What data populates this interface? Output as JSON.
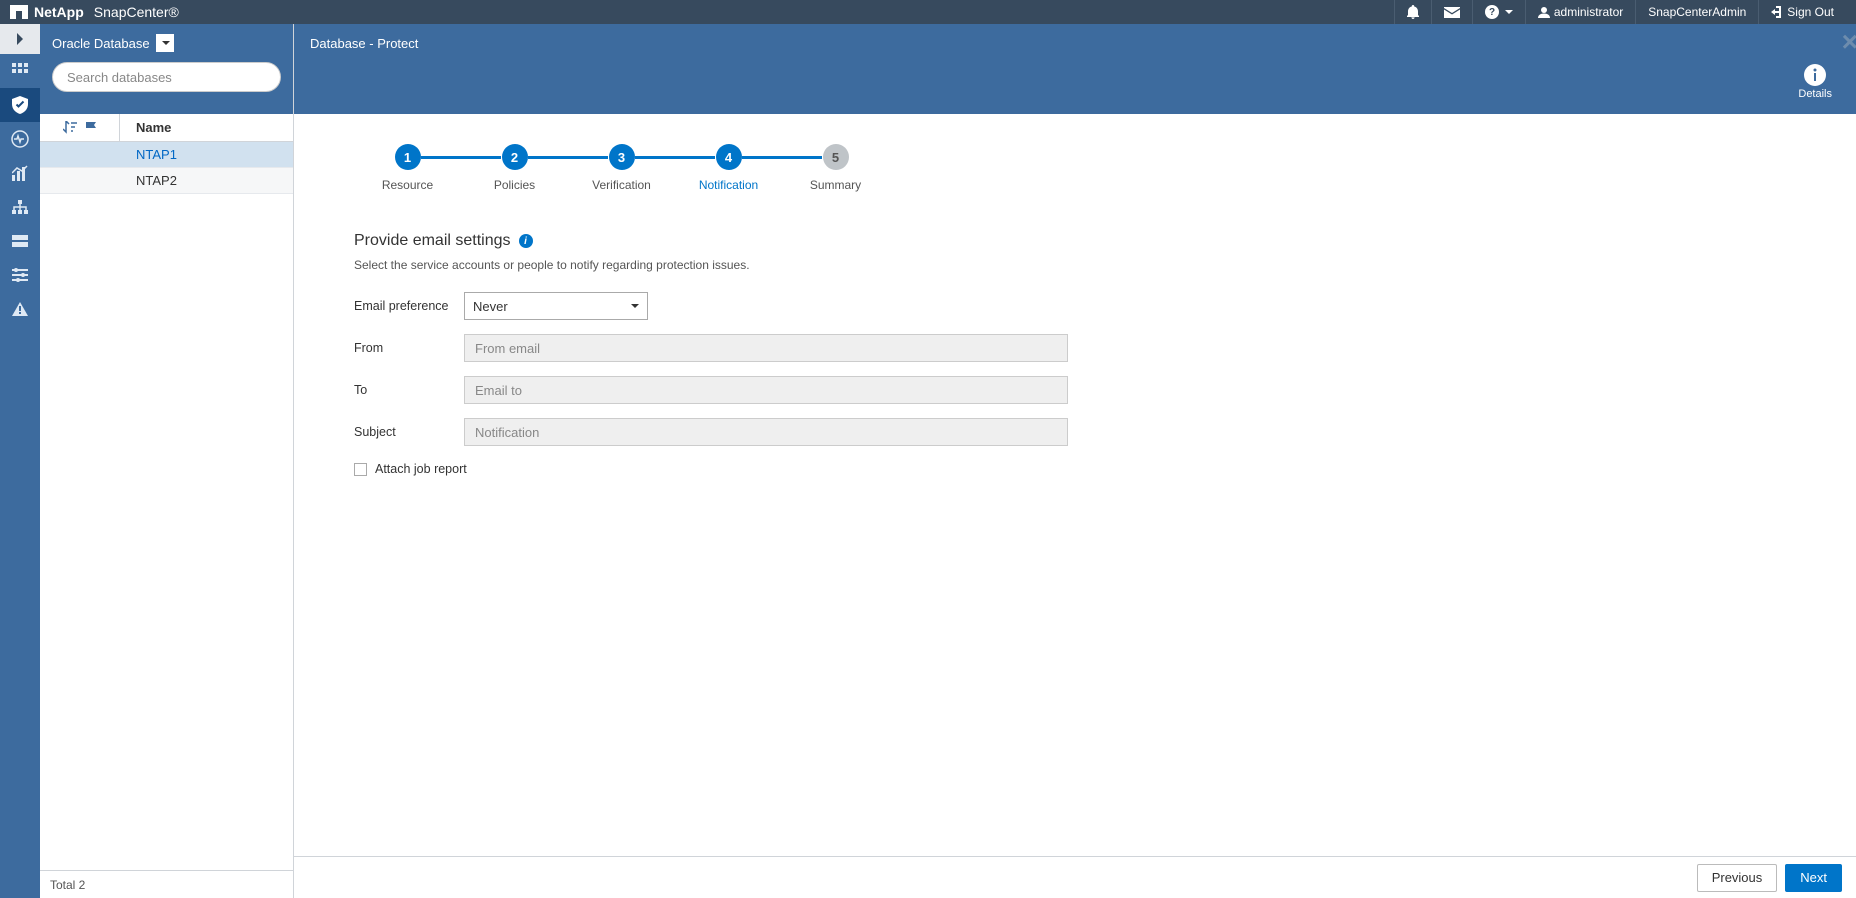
{
  "brand": {
    "company": "NetApp",
    "product": "SnapCenter®"
  },
  "header": {
    "user_label": "administrator",
    "role_label": "SnapCenterAdmin",
    "signout_label": "Sign Out"
  },
  "resource_panel": {
    "selector_label": "Oracle Database",
    "search_placeholder": "Search databases",
    "column_name": "Name",
    "rows": [
      "NTAP1",
      "NTAP2"
    ],
    "total_label": "Total 2"
  },
  "main": {
    "breadcrumb": "Database - Protect",
    "details_label": "Details",
    "steps": [
      {
        "num": "1",
        "label": "Resource"
      },
      {
        "num": "2",
        "label": "Policies"
      },
      {
        "num": "3",
        "label": "Verification"
      },
      {
        "num": "4",
        "label": "Notification"
      },
      {
        "num": "5",
        "label": "Summary"
      }
    ],
    "section_title": "Provide email settings",
    "section_sub": "Select the service accounts or people to notify regarding protection issues.",
    "form": {
      "pref_label": "Email preference",
      "pref_value": "Never",
      "from_label": "From",
      "from_placeholder": "From email",
      "to_label": "To",
      "to_placeholder": "Email to",
      "subject_label": "Subject",
      "subject_placeholder": "Notification",
      "attach_label": "Attach job report"
    },
    "footer": {
      "prev": "Previous",
      "next": "Next"
    }
  }
}
